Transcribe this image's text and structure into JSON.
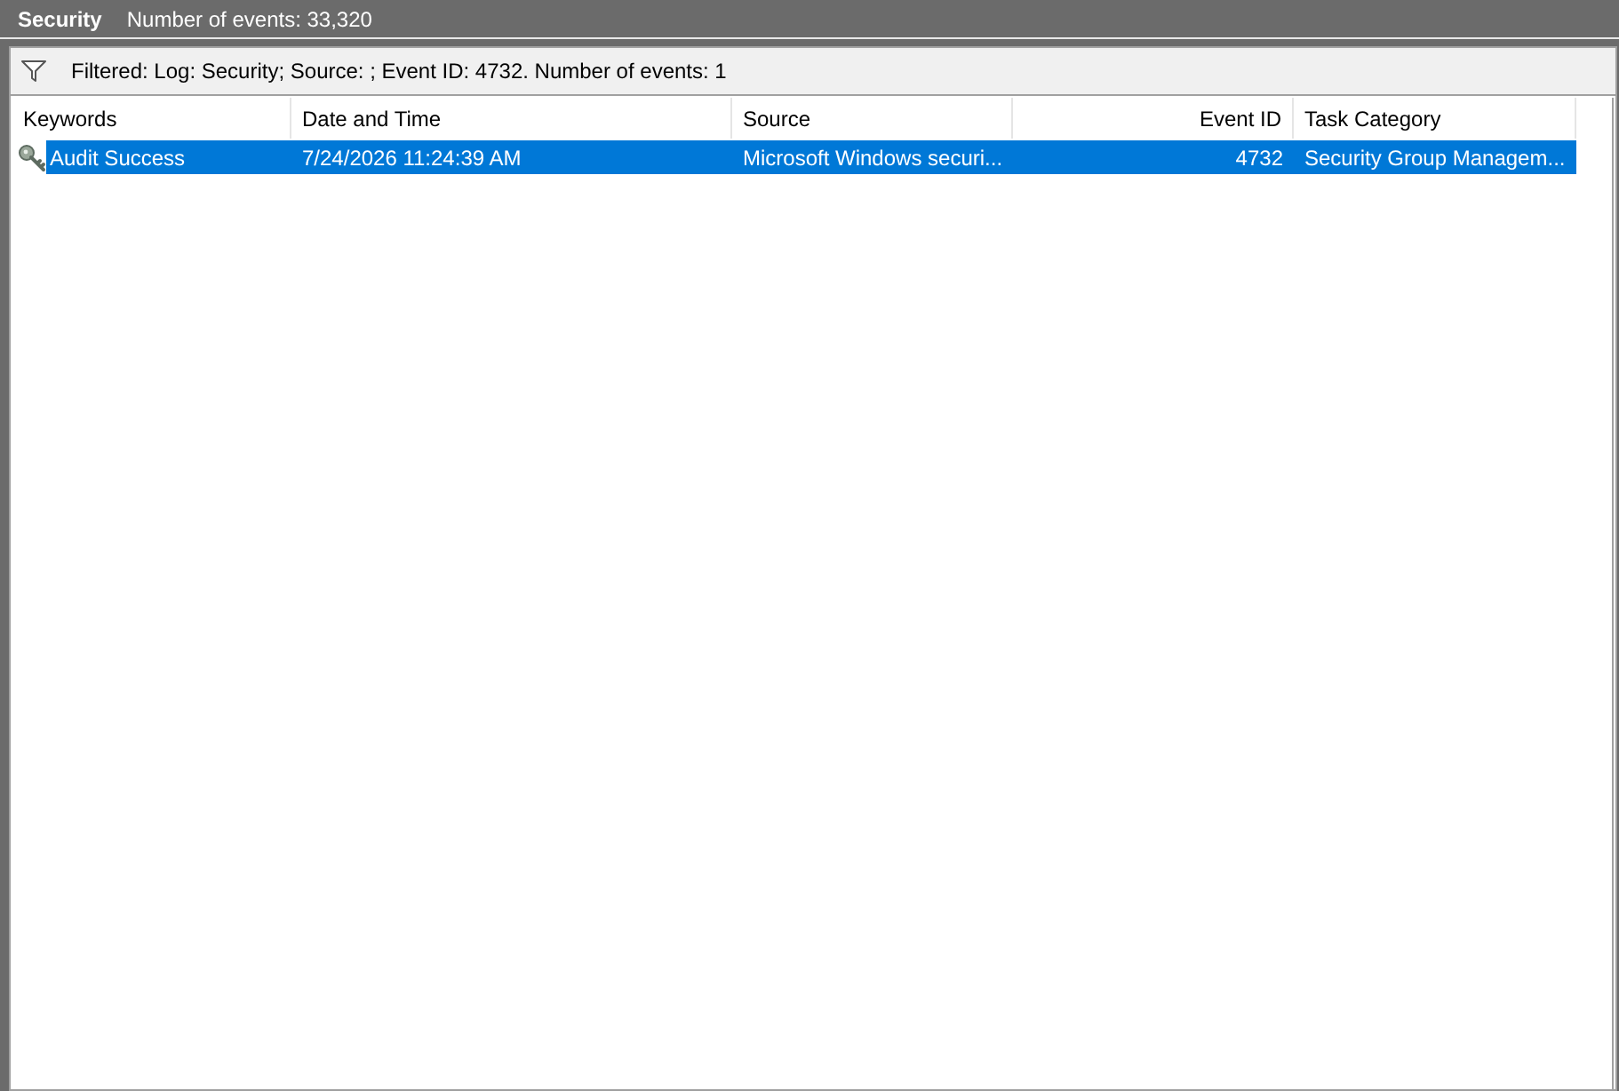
{
  "header": {
    "title": "Security",
    "subtitle": "Number of events: 33,320"
  },
  "filter_bar": {
    "text": "Filtered: Log: Security; Source: ; Event ID: 4732. Number of events: 1"
  },
  "table": {
    "columns": [
      {
        "label": "Keywords",
        "kind": "text"
      },
      {
        "label": "Date and Time",
        "kind": "text"
      },
      {
        "label": "Source",
        "kind": "text"
      },
      {
        "label": "Event ID",
        "kind": "number"
      },
      {
        "label": "Task Category",
        "kind": "text"
      }
    ],
    "rows": [
      {
        "selected": true,
        "cells": [
          "Audit Success",
          "7/24/2026 11:24:39 AM",
          "Microsoft Windows securi...",
          "4732",
          "Security Group Managem..."
        ]
      }
    ]
  }
}
